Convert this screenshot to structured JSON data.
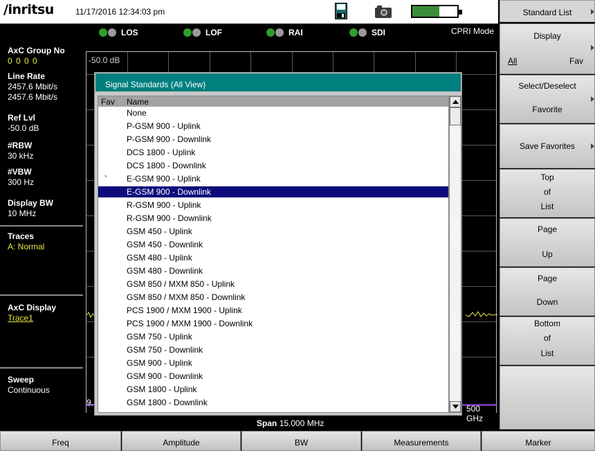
{
  "header": {
    "brand": "/inritsu",
    "datetime": "11/17/2016 12:34:03 pm",
    "save_icon": "floppy-disk-icon",
    "camera_icon": "camera-icon",
    "battery_level": 0.6,
    "battery_fill_color": "#3a8d3a"
  },
  "status": {
    "indicators": [
      {
        "label": "LOS",
        "color": "#2e9e2e"
      },
      {
        "label": "LOF",
        "color": "#2e9e2e"
      },
      {
        "label": "RAI",
        "color": "#2e9e2e"
      },
      {
        "label": "SDI",
        "color": "#2e9e2e"
      }
    ],
    "mode": "CPRI Mode"
  },
  "left_panel": {
    "axc_group_label": "AxC Group No",
    "axc_group_value": "0 0 0 0",
    "line_rate_label": "Line Rate",
    "line_rate_value1": "2457.6 Mbit/s",
    "line_rate_value2": "2457.6 Mbit/s",
    "ref_lvl_label": "Ref Lvl",
    "ref_lvl_value": "-50.0 dB",
    "rbw_label": "#RBW",
    "rbw_value": "30 kHz",
    "vbw_label": "#VBW",
    "vbw_value": "300 Hz",
    "display_bw_label": "Display BW",
    "display_bw_value": "10 MHz",
    "traces_label": "Traces",
    "traces_value": "A: Normal",
    "axc_display_label": "AxC Display",
    "axc_display_value": "Trace1",
    "sweep_label": "Sweep",
    "sweep_value": "Continuous"
  },
  "graph": {
    "ref_level": "-50.0 dB",
    "start_freq_fragment": "9.",
    "stop_freq_fragment": "500 GHz",
    "span_label": "Span",
    "span_value": "15.000 MHz"
  },
  "dialog": {
    "title": "Signal Standards (All View)",
    "col_fav": "Fav",
    "col_name": "Name",
    "rows": [
      {
        "fav": "",
        "name": "None"
      },
      {
        "fav": "",
        "name": "P-GSM 900 - Uplink"
      },
      {
        "fav": "",
        "name": "P-GSM 900 - Downlink"
      },
      {
        "fav": "",
        "name": "DCS 1800 - Uplink"
      },
      {
        "fav": "",
        "name": "DCS 1800 - Downlink"
      },
      {
        "fav": "*",
        "name": "E-GSM 900 - Uplink"
      },
      {
        "fav": "",
        "name": "E-GSM 900 - Downlink",
        "selected": true
      },
      {
        "fav": "",
        "name": "R-GSM 900 - Uplink"
      },
      {
        "fav": "",
        "name": "R-GSM 900 - Downlink"
      },
      {
        "fav": "",
        "name": "GSM 450 - Uplink"
      },
      {
        "fav": "",
        "name": "GSM 450 - Downlink"
      },
      {
        "fav": "",
        "name": "GSM 480 - Uplink"
      },
      {
        "fav": "",
        "name": "GSM 480 - Downlink"
      },
      {
        "fav": "",
        "name": "GSM 850 / MXM 850 - Uplink"
      },
      {
        "fav": "",
        "name": "GSM 850 / MXM 850 - Downlink"
      },
      {
        "fav": "",
        "name": "PCS 1900 / MXM 1900 - Uplink"
      },
      {
        "fav": "",
        "name": "PCS 1900 / MXM 1900 - Downlink"
      },
      {
        "fav": "",
        "name": "GSM 750 - Uplink"
      },
      {
        "fav": "",
        "name": "GSM 750 - Downlink"
      },
      {
        "fav": "",
        "name": "GSM 900 - Uplink"
      },
      {
        "fav": "",
        "name": "GSM 900 - Downlink"
      },
      {
        "fav": "",
        "name": "GSM 1800 - Uplink"
      },
      {
        "fav": "",
        "name": "GSM 1800 - Downlink"
      }
    ],
    "scroll_position": 0
  },
  "softkeys": {
    "title": "Standard List",
    "display": {
      "line1": "Display",
      "all": "All",
      "fav": "Fav"
    },
    "select_deselect": {
      "line1": "Select/Deselect",
      "line2": "Favorite"
    },
    "save_favorites": "Save Favorites",
    "top_of_list": {
      "line1": "Top",
      "line2": "of",
      "line3": "List"
    },
    "page_up": {
      "line1": "Page",
      "line2": "Up"
    },
    "page_down": {
      "line1": "Page",
      "line2": "Down"
    },
    "bottom_of_list": {
      "line1": "Bottom",
      "line2": "of",
      "line3": "List"
    }
  },
  "bottom_menu": {
    "freq": "Freq",
    "amplitude": "Amplitude",
    "bw": "BW",
    "measurements": "Measurements",
    "marker": "Marker"
  }
}
